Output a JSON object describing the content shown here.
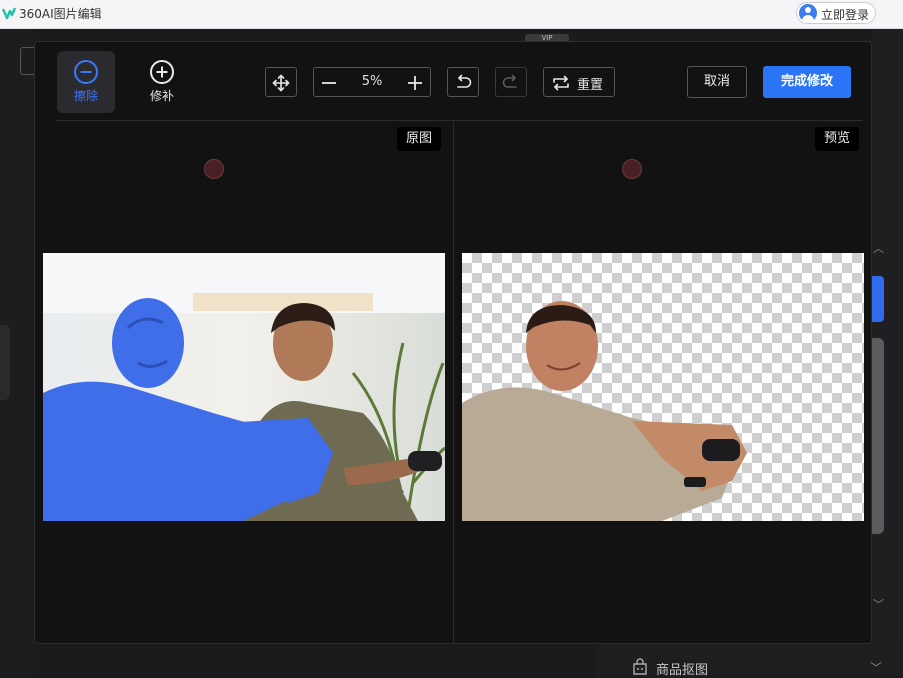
{
  "app": {
    "title": "360AI图片编辑",
    "login_label": "立即登录"
  },
  "background": {
    "vip_label": "VIP",
    "product_cutout_label": "商品抠图"
  },
  "toolbar": {
    "erase_label": "擦除",
    "repair_label": "修补",
    "zoom_value": "5%",
    "reset_label": "重置",
    "cancel_label": "取消",
    "done_label": "完成修改"
  },
  "panes": {
    "original_label": "原图",
    "preview_label": "预览"
  },
  "colors": {
    "accent": "#2a74f5",
    "mask": "#3f6ee8",
    "cursor": "#4a2024"
  }
}
